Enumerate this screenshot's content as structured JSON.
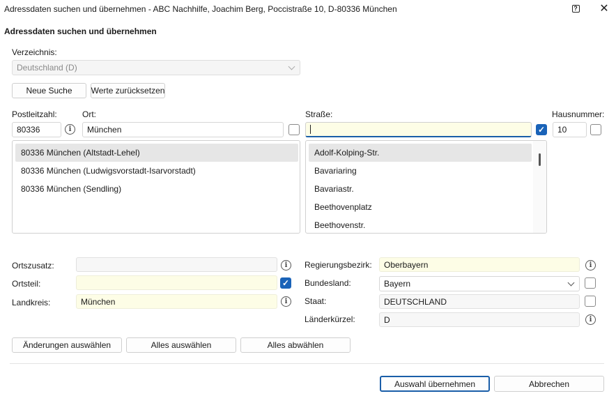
{
  "window": {
    "title": "Adressdaten suchen und übernehmen - ABC Nachhilfe, Joachim Berg, Poccistraße 10, D-80336 München",
    "help_glyph": "?",
    "close_glyph": "✕"
  },
  "section_title": "Adressdaten suchen und übernehmen",
  "verzeichnis": {
    "label": "Verzeichnis:",
    "value": "Deutschland (D)"
  },
  "buttons": {
    "neue_suche": "Neue Suche",
    "werte_zuruecksetzen": "Werte zurücksetzen",
    "aenderungen_auswaehlen": "Änderungen auswählen",
    "alles_auswaehlen": "Alles auswählen",
    "alles_abwaehlen": "Alles abwählen",
    "auswahl_uebernehmen": "Auswahl übernehmen",
    "abbrechen": "Abbrechen"
  },
  "search": {
    "plz_label": "Postleitzahl:",
    "plz_value": "80336",
    "ort_label": "Ort:",
    "ort_value": "München",
    "strasse_label": "Straße:",
    "strasse_value": "",
    "hausnummer_label": "Hausnummer:",
    "hausnummer_value": "10"
  },
  "orte_list": [
    "80336 München (Altstadt-Lehel)",
    "80336 München (Ludwigsvorstadt-Isarvorstadt)",
    "80336 München (Sendling)"
  ],
  "strassen_list": [
    "Adolf-Kolping-Str.",
    "Bavariaring",
    "Bavariastr.",
    "Beethovenplatz",
    "Beethovenstr."
  ],
  "details_left": {
    "ortszusatz_label": "Ortszusatz:",
    "ortszusatz_value": "",
    "ortsteil_label": "Ortsteil:",
    "ortsteil_value": "",
    "landkreis_label": "Landkreis:",
    "landkreis_value": "München"
  },
  "details_right": {
    "regierungsbezirk_label": "Regierungsbezirk:",
    "regierungsbezirk_value": "Oberbayern",
    "bundesland_label": "Bundesland:",
    "bundesland_value": "Bayern",
    "staat_label": "Staat:",
    "staat_value": "DEUTSCHLAND",
    "laenderkuerzel_label": "Länderkürzel:",
    "laenderkuerzel_value": "D"
  },
  "icons": {
    "info": "i",
    "check": "✓"
  },
  "colors": {
    "accent": "#1a63b8",
    "field_yellow": "#fdfde6",
    "selected_row": "#e6e6e6"
  }
}
